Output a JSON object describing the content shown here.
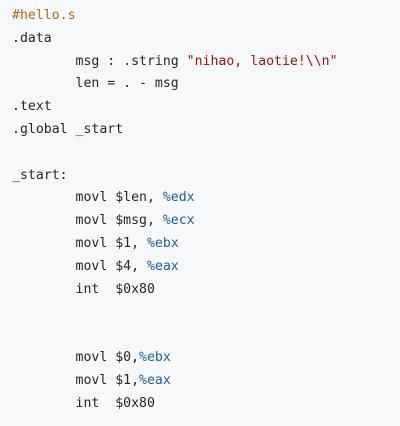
{
  "colors": {
    "background": "#f6f8fa",
    "text": "#24292e",
    "comment": "#b36b1f",
    "string": "#a31515",
    "register": "#1f5fa0"
  },
  "code": {
    "lines": [
      [
        {
          "t": "#hello.s",
          "c": "comment"
        }
      ],
      [
        {
          "t": ".data",
          "c": "plain"
        }
      ],
      [
        {
          "t": "        msg : .string ",
          "c": "plain"
        },
        {
          "t": "\"nihao, laotie!\\\\n\"",
          "c": "string"
        }
      ],
      [
        {
          "t": "        len = . - msg",
          "c": "plain"
        }
      ],
      [
        {
          "t": ".text",
          "c": "plain"
        }
      ],
      [
        {
          "t": ".global _start",
          "c": "plain"
        }
      ],
      [
        {
          "t": "",
          "c": "plain"
        }
      ],
      [
        {
          "t": "_start:",
          "c": "plain"
        }
      ],
      [
        {
          "t": "        movl $len, ",
          "c": "plain"
        },
        {
          "t": "%edx",
          "c": "reg"
        }
      ],
      [
        {
          "t": "        movl $msg, ",
          "c": "plain"
        },
        {
          "t": "%ecx",
          "c": "reg"
        }
      ],
      [
        {
          "t": "        movl $1, ",
          "c": "plain"
        },
        {
          "t": "%ebx",
          "c": "reg"
        }
      ],
      [
        {
          "t": "        movl $4, ",
          "c": "plain"
        },
        {
          "t": "%eax",
          "c": "reg"
        }
      ],
      [
        {
          "t": "        int  $0x80",
          "c": "plain"
        }
      ],
      [
        {
          "t": "",
          "c": "plain"
        }
      ],
      [
        {
          "t": "",
          "c": "plain"
        }
      ],
      [
        {
          "t": "        movl $0,",
          "c": "plain"
        },
        {
          "t": "%ebx",
          "c": "reg"
        }
      ],
      [
        {
          "t": "        movl $1,",
          "c": "plain"
        },
        {
          "t": "%eax",
          "c": "reg"
        }
      ],
      [
        {
          "t": "        int  $0x80",
          "c": "plain"
        }
      ]
    ]
  }
}
